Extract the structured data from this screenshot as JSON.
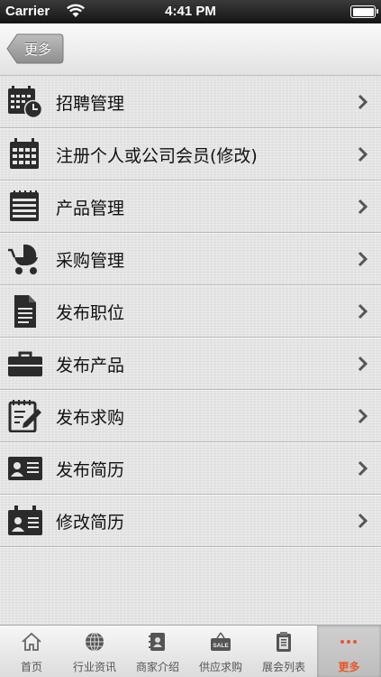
{
  "status_bar": {
    "carrier": "Carrier",
    "time": "4:41 PM"
  },
  "nav": {
    "back_label": "更多"
  },
  "menu": [
    {
      "label": "招聘管理",
      "icon": "calendar-clock-icon"
    },
    {
      "label": "注册个人或公司会员(修改)",
      "icon": "calendar-icon"
    },
    {
      "label": "产品管理",
      "icon": "notepad-icon"
    },
    {
      "label": "采购管理",
      "icon": "stroller-icon"
    },
    {
      "label": "发布职位",
      "icon": "document-icon"
    },
    {
      "label": "发布产品",
      "icon": "briefcase-icon"
    },
    {
      "label": "发布求购",
      "icon": "pencil-notepad-icon"
    },
    {
      "label": "发布简历",
      "icon": "id-card-icon"
    },
    {
      "label": "修改简历",
      "icon": "id-card-clipboard-icon"
    }
  ],
  "tabs": [
    {
      "label": "首页",
      "icon": "home-icon"
    },
    {
      "label": "行业资讯",
      "icon": "globe-icon"
    },
    {
      "label": "商家介绍",
      "icon": "contact-book-icon"
    },
    {
      "label": "供应求购",
      "icon": "sale-tag-icon"
    },
    {
      "label": "展会列表",
      "icon": "clipboard-icon"
    },
    {
      "label": "更多",
      "icon": "more-dots-icon",
      "active": true
    }
  ],
  "colors": {
    "active_tab": "#e8572a",
    "icon": "#2b2b2b"
  }
}
